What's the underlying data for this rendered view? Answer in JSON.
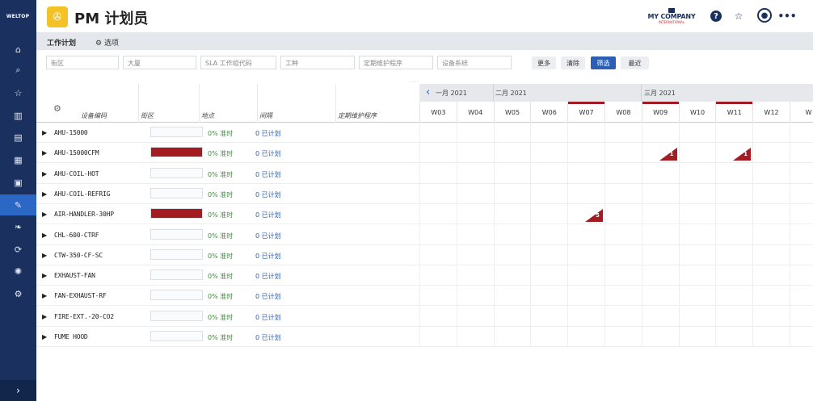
{
  "brand": {
    "logo_text": "WELTOP"
  },
  "sidebar": {
    "items": [
      {
        "icon": "home-icon",
        "glyph": "⌂"
      },
      {
        "icon": "search-icon",
        "glyph": "⌕"
      },
      {
        "icon": "star-icon",
        "glyph": "☆"
      },
      {
        "icon": "building-icon",
        "glyph": "▥"
      },
      {
        "icon": "chart-icon",
        "glyph": "▤"
      },
      {
        "icon": "calendar-icon",
        "glyph": "▦"
      },
      {
        "icon": "report-icon",
        "glyph": "▣"
      },
      {
        "icon": "wrench-icon",
        "glyph": "✎",
        "active": true
      },
      {
        "icon": "leaf-icon",
        "glyph": "❧"
      },
      {
        "icon": "sync-icon",
        "glyph": "⟳"
      },
      {
        "icon": "bulb-icon",
        "glyph": "✺"
      },
      {
        "icon": "settings-icon",
        "glyph": "⚙"
      }
    ],
    "expand_glyph": "›"
  },
  "header": {
    "title": "PM 计划员",
    "company_name": "MY COMPANY",
    "company_sub": "INTERNATIONAL"
  },
  "tabs": {
    "work_plan": "工作计划",
    "options": "选项"
  },
  "filters": {
    "district": "街区",
    "building": "大厦",
    "sla": "SLA  工作组代码",
    "trade": "工种",
    "pm_procedure": "定期维护程序",
    "equipment_system": "设备系统"
  },
  "buttons": {
    "more": "更多",
    "clear": "清除",
    "filter": "筛选",
    "recent": "最近"
  },
  "columns": {
    "equipment_code": "设备编码",
    "district": "街区",
    "location": "地点",
    "interval": "间隔",
    "pm_procedure": "定期维护程序"
  },
  "months": [
    "一月 2021",
    "二月 2021",
    "三月 2021"
  ],
  "weeks": [
    "W03",
    "W04",
    "W05",
    "W06",
    "W07",
    "W08",
    "W09",
    "W10",
    "W11",
    "W12",
    "W"
  ],
  "week_highlight": [
    false,
    false,
    false,
    false,
    true,
    false,
    true,
    false,
    true,
    false,
    false
  ],
  "rows": [
    {
      "name": "AHU-15000",
      "fill": 0,
      "ontime": "0% 准时",
      "planned": "0 已计划",
      "markers": []
    },
    {
      "name": "AHU-15000CFM",
      "fill": 1,
      "ontime": "0% 准时",
      "planned": "0 已计划",
      "markers": [
        {
          "week": 6,
          "count": "1"
        },
        {
          "week": 8,
          "count": "1"
        }
      ]
    },
    {
      "name": "AHU-COIL-HOT",
      "fill": 0,
      "ontime": "0% 准时",
      "planned": "0 已计划",
      "markers": []
    },
    {
      "name": "AHU-COIL-REFRIG",
      "fill": 0,
      "ontime": "0% 准时",
      "planned": "0 已计划",
      "markers": []
    },
    {
      "name": "AIR-HANDLER-30HP",
      "fill": 1,
      "ontime": "0% 准时",
      "planned": "0 已计划",
      "markers": [
        {
          "week": 4,
          "count": "5"
        }
      ]
    },
    {
      "name": "CHL-600-CTRF",
      "fill": 0,
      "ontime": "0% 准时",
      "planned": "0 已计划",
      "markers": []
    },
    {
      "name": "CTW-350-CF-SC",
      "fill": 0,
      "ontime": "0% 准时",
      "planned": "0 已计划",
      "markers": []
    },
    {
      "name": "EXHAUST-FAN",
      "fill": 0,
      "ontime": "0% 准时",
      "planned": "0 已计划",
      "markers": []
    },
    {
      "name": "FAN-EXHAUST-RF",
      "fill": 0,
      "ontime": "0% 准时",
      "planned": "0 已计划",
      "markers": []
    },
    {
      "name": "FIRE-EXT.-20-CO2",
      "fill": 0,
      "ontime": "0% 准时",
      "planned": "0 已计划",
      "markers": []
    },
    {
      "name": "FUME HOOD",
      "fill": 0,
      "ontime": "0% 准时",
      "planned": "0 已计划",
      "markers": []
    }
  ],
  "colors": {
    "accent": "#2b5fb4",
    "sidebar": "#1a3160",
    "danger": "#a31c22",
    "ontime": "#3d8b3d"
  }
}
